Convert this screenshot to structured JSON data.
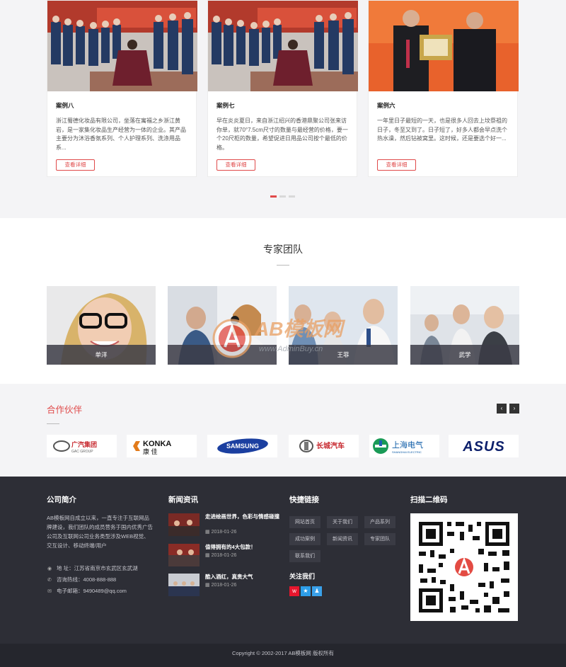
{
  "cases": {
    "items": [
      {
        "title": "案例八",
        "desc": "浙江蜀德化妆品有限公司，坐落在寓福之乡浙江黄岩，是一家集化妆品生产经营为一体的企业。其产品主要分为沐浴香氛系列、个人护理系列、洗涤用品系...",
        "button": "查看详细"
      },
      {
        "title": "案例七",
        "desc": "早在炎炎夏日，来自浙江绍兴的香港鼎聚公司张来访你单，就70°7.5cm尺寸的数量与最经营的价格，要一个20尺柜的数量，希望促进日用品公司按个最低的价格。",
        "button": "查看详细"
      },
      {
        "title": "案例六",
        "desc": "一年里日子最短的一天，也是很多人回去上坟祭祖的日子，冬至又到了。日子短了，好多人都会早点洗个热水澡，然后钻被窝里。这时候，还是要选个好一...",
        "button": "查看详细"
      }
    ],
    "dots": 3
  },
  "experts": {
    "title": "专家团队",
    "members": [
      {
        "name": "单洋"
      },
      {
        "name": ""
      },
      {
        "name": "王菲"
      },
      {
        "name": "武学"
      }
    ]
  },
  "partners": {
    "title": "合作伙伴",
    "prev": "‹",
    "next": "›",
    "logos": [
      {
        "text": "广汽集团",
        "sub": "GAC GROUP"
      },
      {
        "text": "KONKA",
        "sub": "康 佳"
      },
      {
        "text": "SAMSUNG",
        "sub": ""
      },
      {
        "text": "长城汽车",
        "sub": ""
      },
      {
        "text": "上海电气",
        "sub": "SHANGHAI ELECTRIC"
      },
      {
        "text": "ASUS",
        "sub": ""
      }
    ]
  },
  "watermark": {
    "brand": "AB模板网",
    "url": "www.AdminBuy.cn"
  },
  "footer": {
    "about": {
      "title": "公司简介",
      "text": "AB模板网自成立以来，一直专注于互联网品牌建设，我们团队的成员营务于国内优秀广告公司及互联网公司业务类型涉及WEB视觉、交互设计、移动终端/用户",
      "address": "地  址：江苏省南京市玄武区玄武湖",
      "phone": "咨询热线：4008-888-888",
      "email": "电子邮箱：9490489@qq.com"
    },
    "news": {
      "title": "新闻资讯",
      "items": [
        {
          "title": "走进绘画世界，色彩与情感碰撞",
          "date": "2018-01-26"
        },
        {
          "title": "值得拥有的4大包款！",
          "date": "2018-01-26"
        },
        {
          "title": "酷入酒红，真贵大气",
          "date": "2018-01-26"
        }
      ]
    },
    "links": {
      "title": "快捷链接",
      "items": [
        "网站首页",
        "关于我们",
        "产品系列",
        "成功案例",
        "新闻资讯",
        "专家团队",
        "联系我们"
      ],
      "follow_title": "关注我们"
    },
    "qr": {
      "title": "扫描二维码"
    },
    "copyright": "Copyright © 2002-2017 AB模板网 版权所有"
  },
  "colors": {
    "accent": "#e04a4a",
    "footer_bg": "#2d2e36",
    "weibo": "#e6162d",
    "qzone": "#2d9de8",
    "qq": "#3aa1ea"
  }
}
